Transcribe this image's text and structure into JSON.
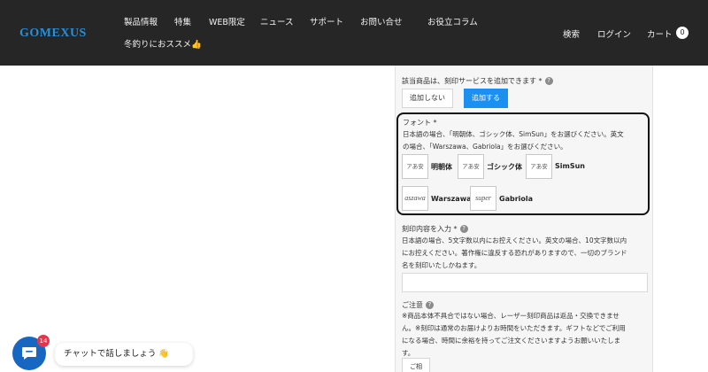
{
  "header": {
    "logo": "GOMEXUS",
    "nav": [
      "製品情報",
      "特集",
      "WEB限定",
      "ニュース",
      "サポート",
      "お問い合せ",
      "お役立コラム",
      "冬釣りにおススメ👍"
    ],
    "search": "検索",
    "login": "ログイン",
    "cart": "カート",
    "cart_count": "0"
  },
  "engraving": {
    "question": "該当商品は、刻印サービスを追加できます *",
    "options": [
      "追加しない",
      "追加する"
    ],
    "selected": "追加する",
    "help_icon": "question-icon"
  },
  "font": {
    "label": "フォント *",
    "desc_line1": "日本語の場合、「明朝体、ゴシック体、SimSun」をお選びください。英文",
    "desc_line2": "の場合、「Warszawa、Gabriola」をお選びください。",
    "choices": [
      {
        "preview": "アあ安",
        "name": "明朝体"
      },
      {
        "preview": "アあ安",
        "name": "ゴシック体"
      },
      {
        "preview": "アあ安",
        "name": "SimSun"
      },
      {
        "preview": "aszawa",
        "name": "Warszawa"
      },
      {
        "preview": "super",
        "name": "Gabriola"
      }
    ]
  },
  "content": {
    "label": "刻印内容を入力 *",
    "desc_line1": "日本語の場合、5文字数以内にお控えください。英文の場合、10文字数以内",
    "desc_line2": "にお控えください。著作権に違反する恐れがありますので、一切のブランド",
    "desc_line3": "名を刻印いたしかねます。",
    "value": ""
  },
  "notice": {
    "label": "ご注意",
    "line1": "※商品本体不具合ではない場合、レーザー刻印商品は返品・交換できませ",
    "line2": "ん。※刻印は通常のお届けよりお時間をいただきます。ギフトなどでご利用",
    "line3": "になる場合、時間に余裕を持ってご注文くださいますようお願いいたしま",
    "line4": "す。",
    "button": "ご相"
  },
  "chat": {
    "badge": "14",
    "message": "チャットで話しましょう 👋"
  },
  "colors": {
    "header_bg": "#262626",
    "accent": "#1b8ff2",
    "logo": "#2a8fd6",
    "chat": "#1766c2",
    "badge": "#e8334a"
  }
}
